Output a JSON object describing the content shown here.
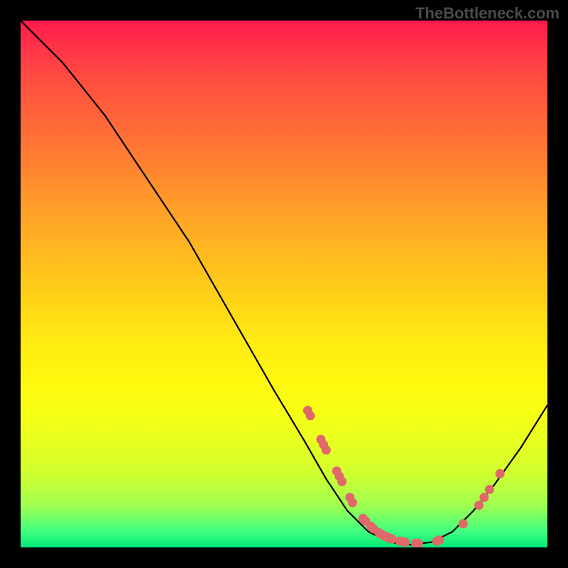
{
  "watermark": "TheBottleneck.com",
  "chart_data": {
    "type": "line",
    "title": "",
    "xlabel": "",
    "ylabel": "",
    "xlim": [
      0,
      100
    ],
    "ylim": [
      0,
      100
    ],
    "curve": [
      {
        "x": 0,
        "y": 100
      },
      {
        "x": 8,
        "y": 92
      },
      {
        "x": 16,
        "y": 82
      },
      {
        "x": 24,
        "y": 70
      },
      {
        "x": 32,
        "y": 58
      },
      {
        "x": 40,
        "y": 44
      },
      {
        "x": 48,
        "y": 30
      },
      {
        "x": 54,
        "y": 20
      },
      {
        "x": 58,
        "y": 13
      },
      {
        "x": 62,
        "y": 7
      },
      {
        "x": 66,
        "y": 3
      },
      {
        "x": 70,
        "y": 1
      },
      {
        "x": 74,
        "y": 0.5
      },
      {
        "x": 78,
        "y": 1
      },
      {
        "x": 82,
        "y": 3
      },
      {
        "x": 86,
        "y": 7
      },
      {
        "x": 90,
        "y": 12
      },
      {
        "x": 95,
        "y": 19
      },
      {
        "x": 100,
        "y": 27
      }
    ],
    "points": [
      {
        "x": 54.5,
        "y": 26
      },
      {
        "x": 55,
        "y": 25
      },
      {
        "x": 57,
        "y": 20.5
      },
      {
        "x": 57.5,
        "y": 19.5
      },
      {
        "x": 58,
        "y": 18.5
      },
      {
        "x": 60,
        "y": 14.5
      },
      {
        "x": 60.5,
        "y": 13.5
      },
      {
        "x": 61,
        "y": 12.5
      },
      {
        "x": 62.5,
        "y": 9.5
      },
      {
        "x": 63,
        "y": 8.5
      },
      {
        "x": 65,
        "y": 5.5
      },
      {
        "x": 65.5,
        "y": 5
      },
      {
        "x": 66.5,
        "y": 4
      },
      {
        "x": 67,
        "y": 3.5
      },
      {
        "x": 68,
        "y": 2.8
      },
      {
        "x": 68.5,
        "y": 2.5
      },
      {
        "x": 69,
        "y": 2.2
      },
      {
        "x": 69.5,
        "y": 2
      },
      {
        "x": 70,
        "y": 1.8
      },
      {
        "x": 70.5,
        "y": 1.6
      },
      {
        "x": 72,
        "y": 1.2
      },
      {
        "x": 72.5,
        "y": 1.1
      },
      {
        "x": 73,
        "y": 1
      },
      {
        "x": 75,
        "y": 0.8
      },
      {
        "x": 75.5,
        "y": 0.8
      },
      {
        "x": 79,
        "y": 1.2
      },
      {
        "x": 79.5,
        "y": 1.4
      },
      {
        "x": 84,
        "y": 4.5
      },
      {
        "x": 87,
        "y": 8
      },
      {
        "x": 88,
        "y": 9.5
      },
      {
        "x": 89,
        "y": 11
      },
      {
        "x": 91,
        "y": 14
      }
    ],
    "colors": {
      "curve": "#000000",
      "points": "#e16868",
      "gradient_top": "#ff1a4d",
      "gradient_bottom": "#00e878",
      "background": "#000000"
    }
  }
}
